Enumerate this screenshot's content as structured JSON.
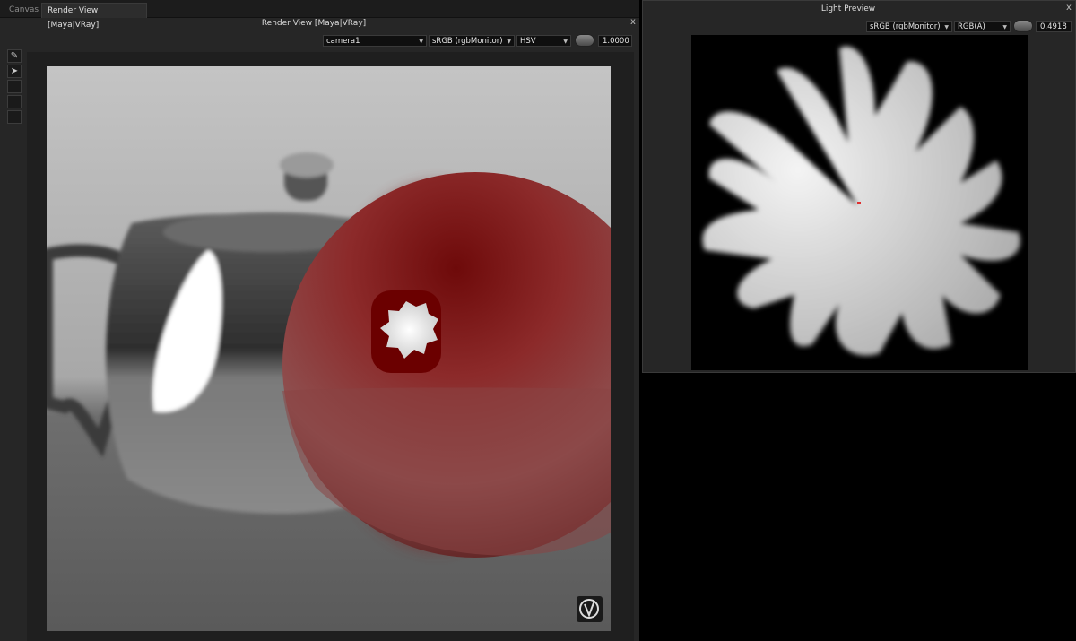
{
  "tabs": [
    {
      "label": "Canvas",
      "active": false
    },
    {
      "label": "Render View [Maya|VRay]",
      "active": true
    }
  ],
  "render_view": {
    "title": "Render View [Maya|VRay]",
    "close_label": "x",
    "camera": "camera1",
    "colorspace": "sRGB (rgbMonitor)",
    "channel": "HSV",
    "exposure": "1.0000",
    "tools": [
      "brush-icon",
      "pointer-icon",
      "empty-tool",
      "empty-tool"
    ]
  },
  "light_preview": {
    "title": "Light Preview",
    "close_label": "x",
    "colorspace": "sRGB (rgbMonitor)",
    "channel": "RGB(A)",
    "exposure": "0.4918"
  },
  "colors": {
    "panel_bg": "#262626",
    "sphere_red": "#8b1a1a",
    "accent": "#e0e0e0"
  }
}
